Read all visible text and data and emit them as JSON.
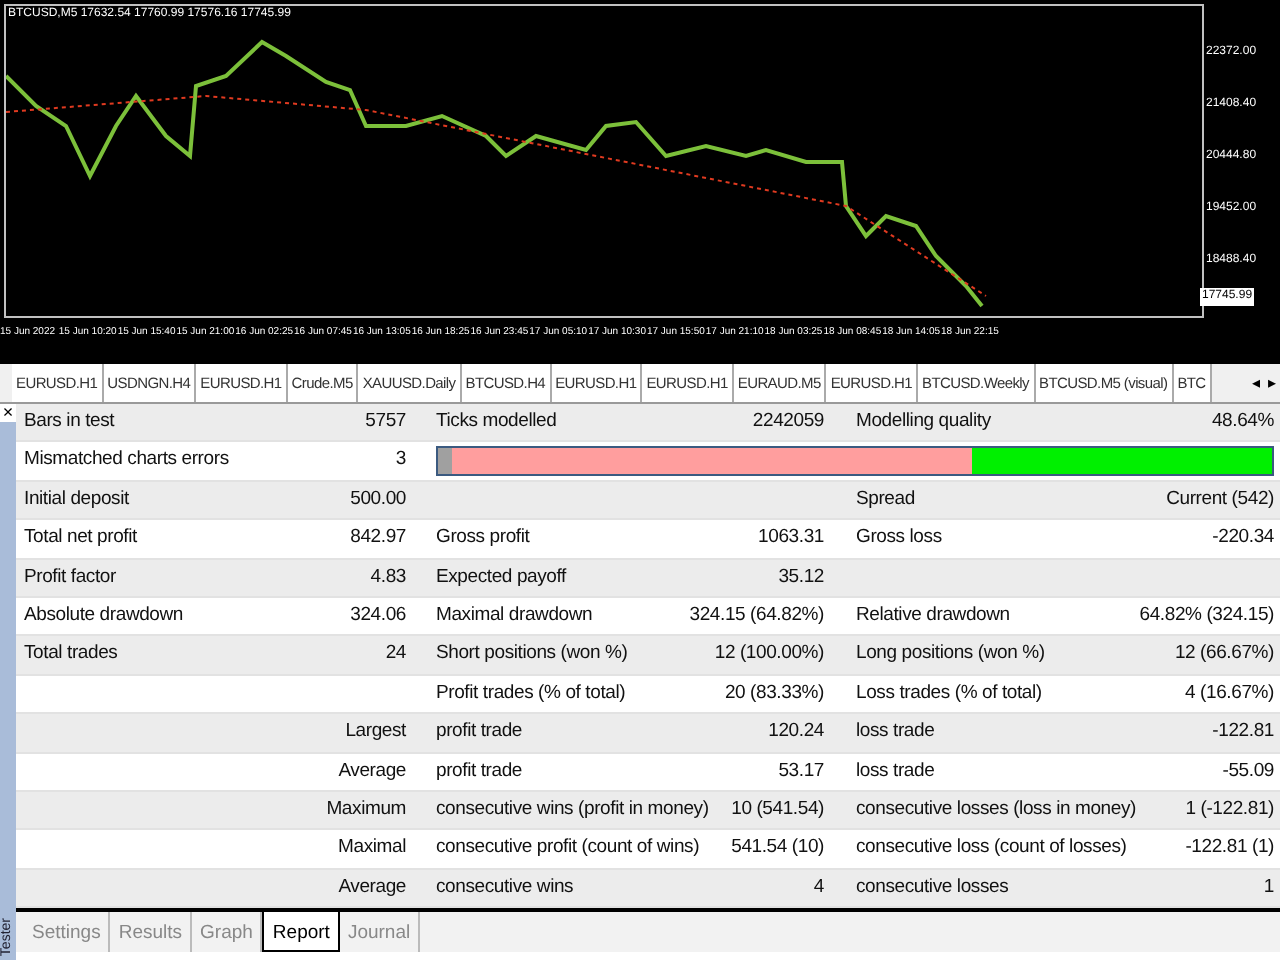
{
  "chart": {
    "title": "BTCUSD,M5  17632.54 17760.99 17576.16 17745.99",
    "price_axis": [
      "22372.00",
      "21408.40",
      "20444.80",
      "19452.00",
      "18488.40"
    ],
    "current_price": "17745.99",
    "time_axis": [
      "15 Jun 2022",
      "15 Jun 10:20",
      "15 Jun 15:40",
      "15 Jun 21:00",
      "16 Jun 02:25",
      "16 Jun 07:45",
      "16 Jun 13:05",
      "16 Jun 18:25",
      "16 Jun 23:45",
      "17 Jun 05:10",
      "17 Jun 10:30",
      "17 Jun 15:50",
      "17 Jun 21:10",
      "18 Jun 03:25",
      "18 Jun 08:45",
      "18 Jun 14:05",
      "18 Jun 22:15"
    ]
  },
  "chart_tabs": [
    {
      "label": "EURUSD.H1",
      "selected": false
    },
    {
      "label": "USDNGN.H4",
      "selected": false
    },
    {
      "label": "EURUSD.H1",
      "selected": false
    },
    {
      "label": "Crude.M5",
      "selected": false
    },
    {
      "label": "XAUUSD.Daily",
      "selected": false
    },
    {
      "label": "BTCUSD.H4",
      "selected": false
    },
    {
      "label": "EURUSD.H1",
      "selected": false
    },
    {
      "label": "EURUSD.H1",
      "selected": false
    },
    {
      "label": "EURAUD.M5",
      "selected": false
    },
    {
      "label": "EURUSD.H1",
      "selected": false
    },
    {
      "label": "BTCUSD.Weekly",
      "selected": false
    },
    {
      "label": "BTCUSD.M5 (visual)",
      "selected": false
    },
    {
      "label": "BTC",
      "selected": false
    }
  ],
  "tab_scroll": [
    "◂",
    "▸"
  ],
  "panel": {
    "close": "×",
    "title": "Tester"
  },
  "report": {
    "rows": [
      {
        "label_1": "Bars in test",
        "value_1": "5757",
        "label_2": "Ticks modelled",
        "value_2": "2242059",
        "label_3": "Modelling quality",
        "value_3": "48.64%"
      },
      {
        "label_1": "Mismatched charts errors",
        "value_1": "3",
        "quality_bar": {
          "level": 0.36
        }
      },
      {
        "label_1": "Initial deposit",
        "value_1": "500.00",
        "label_3": "Spread",
        "value_3": "Current (542)"
      },
      {
        "label_1": "Total net profit",
        "value_1": "842.97",
        "label_2": "Gross profit",
        "value_2": "1063.31",
        "label_3": "Gross loss",
        "value_3": "-220.34"
      },
      {
        "label_1": "Profit factor",
        "value_1": "4.83",
        "label_2": "Expected payoff",
        "value_2": "35.12"
      },
      {
        "label_1": "Absolute drawdown",
        "value_1": "324.06",
        "label_2": "Maximal drawdown",
        "value_2": "324.15 (64.82%)",
        "label_3": "Relative drawdown",
        "value_3": "64.82% (324.15)"
      },
      {
        "label_1": "Total trades",
        "value_1": "24",
        "label_2": "Short positions (won %)",
        "value_2": "12 (100.00%)",
        "label_3": "Long positions (won %)",
        "value_3": "12 (66.67%)"
      },
      {
        "label_2": "Profit trades (% of total)",
        "value_2": "20 (83.33%)",
        "label_3": "Loss trades (% of total)",
        "value_3": "4 (16.67%)"
      },
      {
        "value_1": "Largest",
        "label_2": "profit trade",
        "value_2": "120.24",
        "label_3": "loss trade",
        "value_3": "-122.81"
      },
      {
        "value_1": "Average",
        "label_2": "profit trade",
        "value_2": "53.17",
        "label_3": "loss trade",
        "value_3": "-55.09"
      },
      {
        "value_1": "Maximum",
        "label_2": "consecutive wins (profit in money)",
        "value_2": "10 (541.54)",
        "label_3": "consecutive losses (loss in money)",
        "value_3": "1 (-122.81)"
      },
      {
        "value_1": "Maximal",
        "label_2": "consecutive profit (count of wins)",
        "value_2": "541.54 (10)",
        "label_3": "consecutive loss (count of losses)",
        "value_3": "-122.81 (1)"
      },
      {
        "value_1": "Average",
        "label_2": "consecutive wins",
        "value_2": "4",
        "label_3": "consecutive losses",
        "value_3": "1"
      }
    ]
  },
  "tester_tabs": [
    {
      "label": "Settings",
      "selected": false
    },
    {
      "label": "Results",
      "selected": false
    },
    {
      "label": "Graph",
      "selected": false
    },
    {
      "label": "Report",
      "selected": true
    },
    {
      "label": "Journal",
      "selected": false
    }
  ]
}
